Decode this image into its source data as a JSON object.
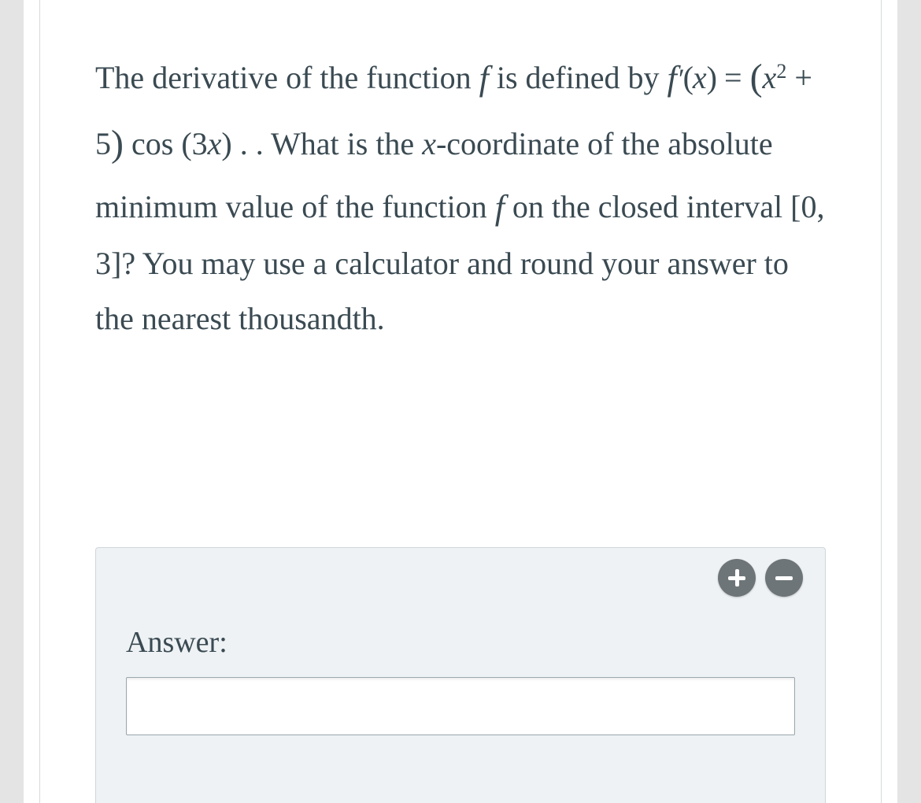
{
  "question": {
    "p1": "The derivative of the function ",
    "p2": " is defined by ",
    "p3": ". What is the ",
    "p4": "-coordinate of the absolute minimum value of the function ",
    "p5": " on the closed interval ",
    "p6": "? You may use a calculator and round your answer to the nearest thousandth."
  },
  "math": {
    "f": "f",
    "fprime_lhs_f": "f",
    "fprime_lhs_prime": "′",
    "fprime_lhs_x": "x",
    "eq": "=",
    "rhs_open": "(",
    "rhs_x": "x",
    "rhs_sq": "2",
    "rhs_plus": "+ 5",
    "rhs_close": ")",
    "cos": "cos",
    "cos_open": "(",
    "cos_three": "3",
    "cos_x": "x",
    "cos_close": ")",
    "interval": "[0, 3]",
    "xvar": "x"
  },
  "answer": {
    "label": "Answer:",
    "value": ""
  },
  "controls": {
    "plus": "plus",
    "minus": "minus"
  }
}
